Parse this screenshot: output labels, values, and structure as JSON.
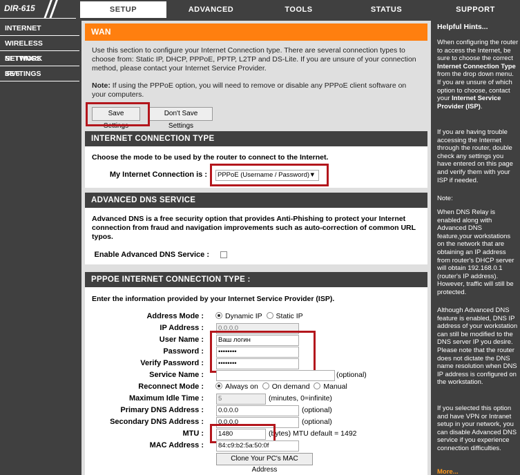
{
  "header": {
    "model": "DIR-615",
    "tabs": [
      "SETUP",
      "ADVANCED",
      "TOOLS",
      "STATUS",
      "SUPPORT"
    ]
  },
  "sidebar": {
    "items": [
      "INTERNET",
      "WIRELESS SETTINGS",
      "NETWORK SETTINGS",
      "IPv6"
    ]
  },
  "wan": {
    "title": "WAN",
    "intro": "Use this section to configure your Internet Connection type. There are several connection types to choose from: Static IP, DHCP, PPPoE, PPTP, L2TP and DS-Lite. If you are unsure of your connection method, please contact your Internet Service Provider.",
    "note_label": "Note:",
    "note": "If using the PPPoE option, you will need to remove or disable any PPPoE client software on your computers.",
    "save_label": "Save Settings",
    "dont_save_label": "Don't Save Settings"
  },
  "conn_type": {
    "title": "INTERNET CONNECTION TYPE",
    "prompt": "Choose the mode to be used by the router to connect to the Internet.",
    "label": "My Internet Connection is :",
    "value": "PPPoE (Username / Password)"
  },
  "adv_dns": {
    "title": "ADVANCED DNS SERVICE",
    "desc": "Advanced DNS is a free security option that provides Anti-Phishing to protect your Internet connection from fraud and navigation improvements such as auto-correction of common URL typos.",
    "enable_label": "Enable Advanced DNS Service :"
  },
  "pppoe": {
    "title": "PPPOE INTERNET CONNECTION TYPE :",
    "intro": "Enter the information provided by your Internet Service Provider (ISP).",
    "address_mode_label": "Address Mode :",
    "dynamic_ip": "Dynamic IP",
    "static_ip": "Static IP",
    "ip_label": "IP Address :",
    "ip_value": "0.0.0.0",
    "user_label": "User Name :",
    "user_value": "Ваш логин",
    "password_label": "Password :",
    "password_value": "••••••••",
    "verify_label": "Verify Password :",
    "verify_value": "••••••••",
    "service_label": "Service Name :",
    "service_hint": "(optional)",
    "reconnect_label": "Reconnect Mode :",
    "always_on": "Always on",
    "on_demand": "On demand",
    "manual": "Manual",
    "idle_label": "Maximum Idle Time :",
    "idle_value": "5",
    "idle_hint": "(minutes, 0=infinite)",
    "pdns_label": "Primary DNS Address :",
    "pdns_value": "0.0.0.0",
    "pdns_hint": "(optional)",
    "sdns_label": "Secondary DNS Address :",
    "sdns_value": "0.0.0.0",
    "sdns_hint": "(optional)",
    "mtu_label": "MTU :",
    "mtu_value": "1480",
    "mtu_hint": "(bytes) MTU default = 1492",
    "mac_label": "MAC Address :",
    "mac_value": "84:c9:b2:5a:50:0f",
    "clone_label": "Clone Your PC's MAC Address"
  },
  "hints": {
    "title": "Helpful Hints...",
    "h1a": "When configuring the router to access the Internet, be sure to choose the correct ",
    "h1b": "Internet Connection Type",
    "h1c": " from the drop down menu. If you are unsure of which option to choose, contact your ",
    "h1d": "Internet Service Provider (ISP)",
    "h1e": ".",
    "h2": "If you are having trouble accessing the Internet through the router, double check any settings you have entered on this page and verify them with your ISP if needed.",
    "h3": "Note:",
    "h4": "When DNS Relay is enabled along with Advanced DNS feature,your workstations on the network that are obtaining an IP address from router's DHCP server will obtain 192.168.0.1 (router's IP address). However, traffic will still be protected.",
    "h5": "Although Advanced DNS feature is enabled, DNS IP address of your workstation can still be modified to the DNS server IP you desire. Please note that the router does not dictate the DNS name resolution when DNS IP address is configured on the workstation.",
    "h6": "If you selected this option and have VPN or Intranet setup in your network, you can disable Advanced DNS service if you experience connection difficulties.",
    "more": "More..."
  },
  "colors": {
    "accent": "#ff7f0f",
    "dark": "#404040",
    "highlight": "#b3161c"
  }
}
